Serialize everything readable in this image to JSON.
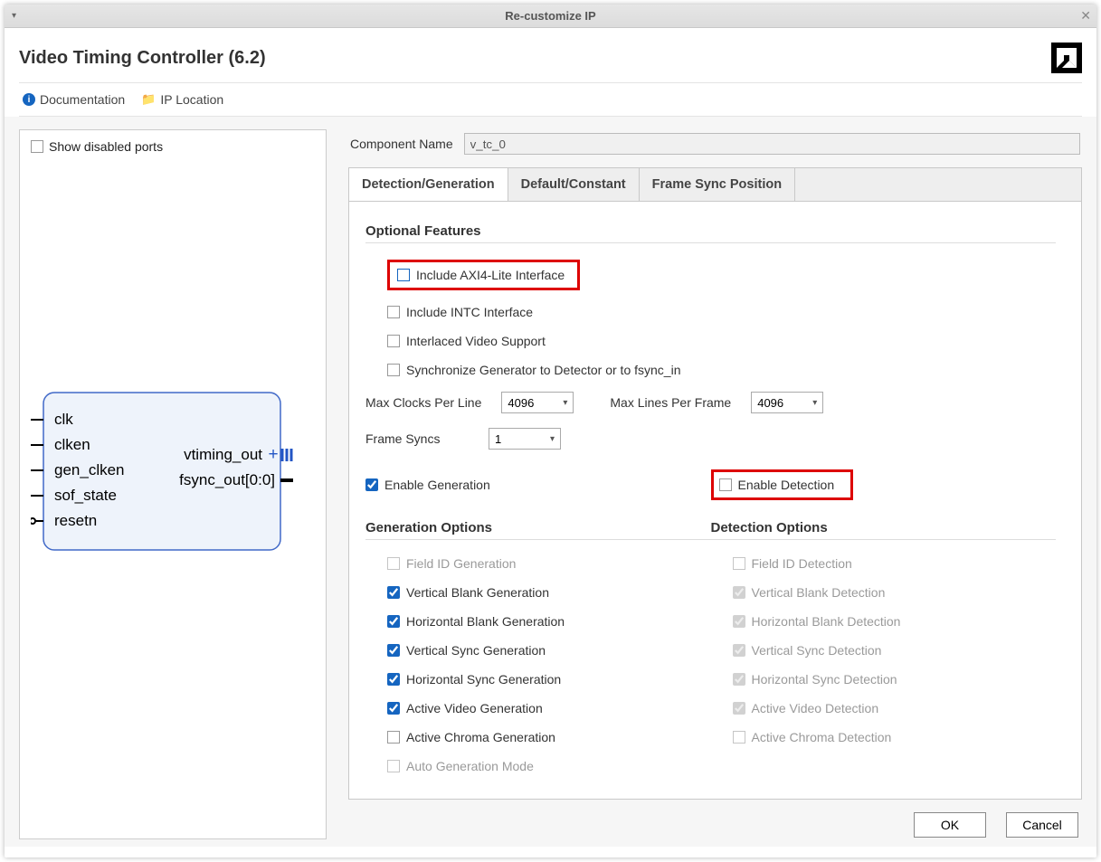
{
  "window": {
    "title": "Re-customize IP"
  },
  "header": {
    "ip_title": "Video Timing Controller (6.2)"
  },
  "subbar": {
    "documentation": "Documentation",
    "ip_location": "IP Location"
  },
  "left": {
    "show_disabled": "Show disabled ports",
    "ports_in": [
      "clk",
      "clken",
      "gen_clken",
      "sof_state",
      "resetn"
    ],
    "ports_out": [
      "vtiming_out",
      "fsync_out[0:0]"
    ]
  },
  "right": {
    "comp_label": "Component Name",
    "comp_value": "v_tc_0",
    "tabs": [
      "Detection/Generation",
      "Default/Constant",
      "Frame Sync Position"
    ],
    "optional_title": "Optional Features",
    "opt_axi": "Include AXI4-Lite Interface",
    "opt_intc": "Include INTC Interface",
    "opt_interlaced": "Interlaced Video Support",
    "opt_sync": "Synchronize Generator to Detector or to fsync_in",
    "maxclk_label": "Max Clocks Per Line",
    "maxclk_val": "4096",
    "maxlines_label": "Max Lines Per Frame",
    "maxlines_val": "4096",
    "fsyncs_label": "Frame Syncs",
    "fsyncs_val": "1",
    "enable_gen": "Enable Generation",
    "enable_det": "Enable Detection",
    "gen_title": "Generation Options",
    "det_title": "Detection Options",
    "gen": {
      "field": "Field ID Generation",
      "vblank": "Vertical Blank Generation",
      "hblank": "Horizontal Blank Generation",
      "vsync": "Vertical Sync Generation",
      "hsync": "Horizontal Sync Generation",
      "active": "Active Video Generation",
      "chroma": "Active Chroma Generation",
      "auto": "Auto Generation Mode"
    },
    "det": {
      "field": "Field ID Detection",
      "vblank": "Vertical Blank Detection",
      "hblank": "Horizontal Blank Detection",
      "vsync": "Vertical Sync Detection",
      "hsync": "Horizontal Sync Detection",
      "active": "Active Video Detection",
      "chroma": "Active Chroma Detection"
    }
  },
  "footer": {
    "ok": "OK",
    "cancel": "Cancel"
  }
}
